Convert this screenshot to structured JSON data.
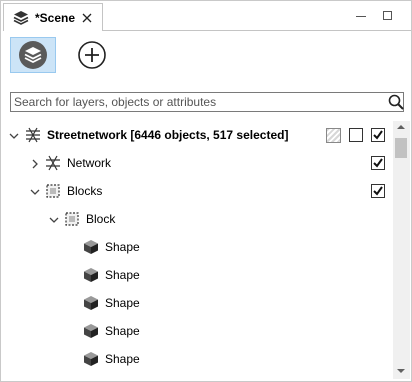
{
  "tab": {
    "title": "*Scene",
    "icon": "layers-stack-icon",
    "close_icon": "close-icon"
  },
  "window_controls": {
    "minimize_icon": "minimize-icon",
    "maximize_icon": "maximize-icon"
  },
  "toolbar": {
    "layers_button": {
      "icon": "layers-stack-icon",
      "pressed": true
    },
    "add_button": {
      "icon": "plus-circle-icon"
    }
  },
  "search": {
    "placeholder": "Search for layers, objects or attributes",
    "value": "",
    "icon": "search-icon"
  },
  "tree": [
    {
      "label": "Streetnetwork [6446 objects, 517 selected]",
      "bold": true,
      "expanded": true,
      "icon": "street-network-icon",
      "level": 0,
      "has_chevron": true,
      "checked": true,
      "extra_controls": [
        "hatch-swatch",
        "empty-box"
      ]
    },
    {
      "label": "Network",
      "bold": false,
      "expanded": false,
      "icon": "network-icon",
      "level": 1,
      "has_chevron": true,
      "checked": true
    },
    {
      "label": "Blocks",
      "bold": false,
      "expanded": true,
      "icon": "blocks-icon",
      "level": 1,
      "has_chevron": true,
      "checked": true
    },
    {
      "label": "Block",
      "bold": false,
      "expanded": true,
      "icon": "block-icon",
      "level": 2,
      "has_chevron": true,
      "checked": null
    },
    {
      "label": "Shape",
      "bold": false,
      "icon": "shape-icon",
      "level": 3,
      "has_chevron": false,
      "checked": null
    },
    {
      "label": "Shape",
      "bold": false,
      "icon": "shape-icon",
      "level": 3,
      "has_chevron": false,
      "checked": null
    },
    {
      "label": "Shape",
      "bold": false,
      "icon": "shape-icon",
      "level": 3,
      "has_chevron": false,
      "checked": null
    },
    {
      "label": "Shape",
      "bold": false,
      "icon": "shape-icon",
      "level": 3,
      "has_chevron": false,
      "checked": null
    },
    {
      "label": "Shape",
      "bold": false,
      "icon": "shape-icon",
      "level": 3,
      "has_chevron": false,
      "checked": null
    }
  ],
  "colors": {
    "selected_button_bg": "#cce4f7",
    "selected_button_border": "#99c9ef",
    "layers_icon_circle": "#5a5a5a"
  }
}
